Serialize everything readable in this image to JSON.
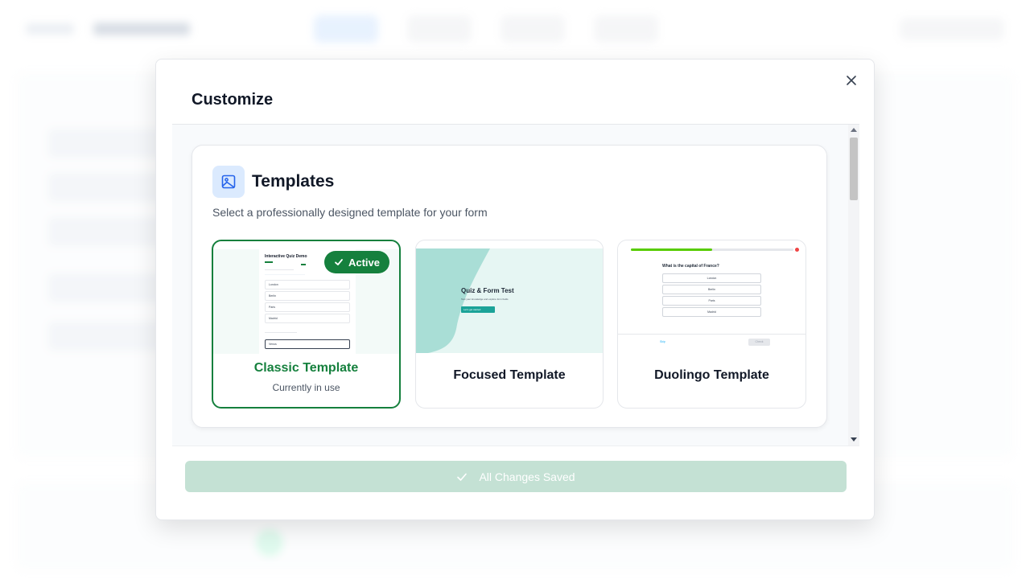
{
  "modal": {
    "title": "Customize"
  },
  "templates_section": {
    "title": "Templates",
    "description": "Select a professionally designed template for your form",
    "active_badge": "Active",
    "items": [
      {
        "name": "Classic Template",
        "subtitle": "Currently in use",
        "active": true,
        "preview": {
          "title": "Interactive Quiz Demo",
          "question": "What is the capital of France?",
          "options": [
            "London",
            "Berlin",
            "Paris",
            "Madrid"
          ],
          "second_question": "What planet is known as the Red Planet?",
          "selected_option": "Venus"
        }
      },
      {
        "name": "Focused Template",
        "subtitle": "",
        "active": false,
        "preview": {
          "title": "Quiz & Form Test",
          "subtitle": "Test your knowledge and explore form fields",
          "button": "Let's get started"
        }
      },
      {
        "name": "Duolingo Template",
        "subtitle": "",
        "active": false,
        "preview": {
          "question": "What is the capital of France?",
          "options": [
            "London",
            "Berlin",
            "Paris",
            "Madrid"
          ],
          "skip": "Skip",
          "check": "Check",
          "progress": 0.5
        }
      }
    ]
  },
  "footer": {
    "save_label": "All Changes Saved"
  },
  "colors": {
    "accent_green": "#15803d",
    "saved_button": "#c4e1d4",
    "icon_bg": "#dbeafe",
    "icon_blue": "#2563eb"
  }
}
